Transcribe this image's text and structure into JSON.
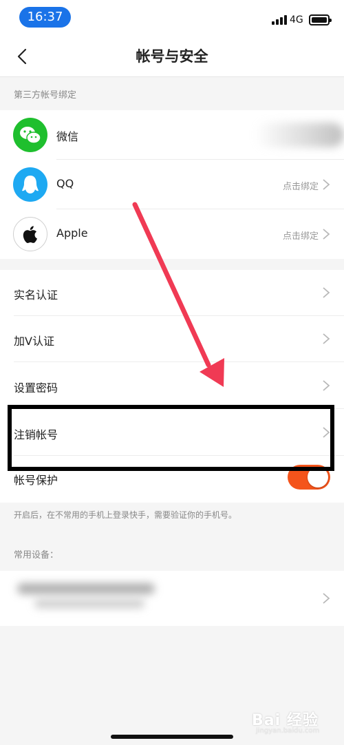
{
  "status_bar": {
    "time": "16:37",
    "network": "4G"
  },
  "header": {
    "title": "帐号与安全"
  },
  "third_party": {
    "section_label": "第三方帐号绑定",
    "items": [
      {
        "label": "微信",
        "icon": "wechat-icon",
        "color": "#1fbf2e",
        "hint": ""
      },
      {
        "label": "QQ",
        "icon": "qq-icon",
        "color": "#1ea9f2",
        "hint": "点击绑定"
      },
      {
        "label": "Apple",
        "icon": "apple-icon",
        "color": "#ffffff",
        "hint": "点击绑定"
      }
    ]
  },
  "security": {
    "items": [
      {
        "label": "实名认证"
      },
      {
        "label": "加V认证"
      },
      {
        "label": "设置密码"
      },
      {
        "label": "注销帐号"
      }
    ],
    "protection": {
      "label": "帐号保护",
      "enabled": true,
      "toggle_color": "#f4541b"
    },
    "help_text": "开启后，在不常用的手机上登录快手，需要验证你的手机号。"
  },
  "devices": {
    "section_label": "常用设备："
  },
  "annotation": {
    "arrow_color": "#f03a54",
    "box_color": "#000000"
  },
  "watermark": {
    "text": "Bai 经验",
    "sub": "jingyan.baidu.com"
  }
}
